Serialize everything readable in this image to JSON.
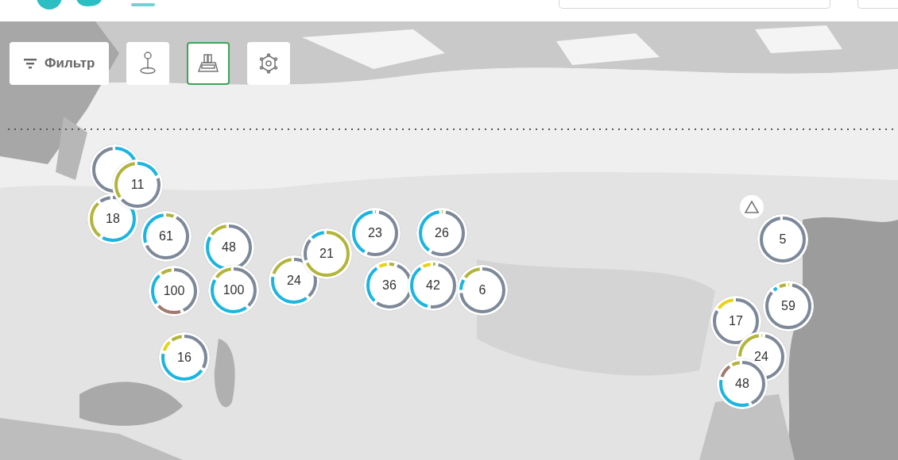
{
  "toolbar": [
    {
      "kind": "filter",
      "label": "Фильтр",
      "selected": false
    },
    {
      "kind": "pin",
      "selected": false
    },
    {
      "kind": "printer",
      "selected": true
    },
    {
      "kind": "gear",
      "selected": false
    }
  ],
  "clusters": [
    {
      "kind": "blank"
    },
    {
      "kind": "count",
      "count": "18"
    },
    {
      "kind": "count",
      "count": "11"
    },
    {
      "kind": "count",
      "count": "61"
    },
    {
      "kind": "count",
      "count": "48"
    },
    {
      "kind": "count",
      "count": "100"
    },
    {
      "kind": "count",
      "count": "100"
    },
    {
      "kind": "count",
      "count": "24"
    },
    {
      "kind": "count",
      "count": "21"
    },
    {
      "kind": "count",
      "count": "23"
    },
    {
      "kind": "count",
      "count": "36"
    },
    {
      "kind": "count",
      "count": "26"
    },
    {
      "kind": "count",
      "count": "42"
    },
    {
      "kind": "count",
      "count": "6"
    },
    {
      "kind": "count",
      "count": "16"
    },
    {
      "kind": "count",
      "count": "5"
    },
    {
      "kind": "count",
      "count": "59"
    },
    {
      "kind": "count",
      "count": "17"
    },
    {
      "kind": "count",
      "count": "24"
    },
    {
      "kind": "count",
      "count": "48"
    }
  ]
}
